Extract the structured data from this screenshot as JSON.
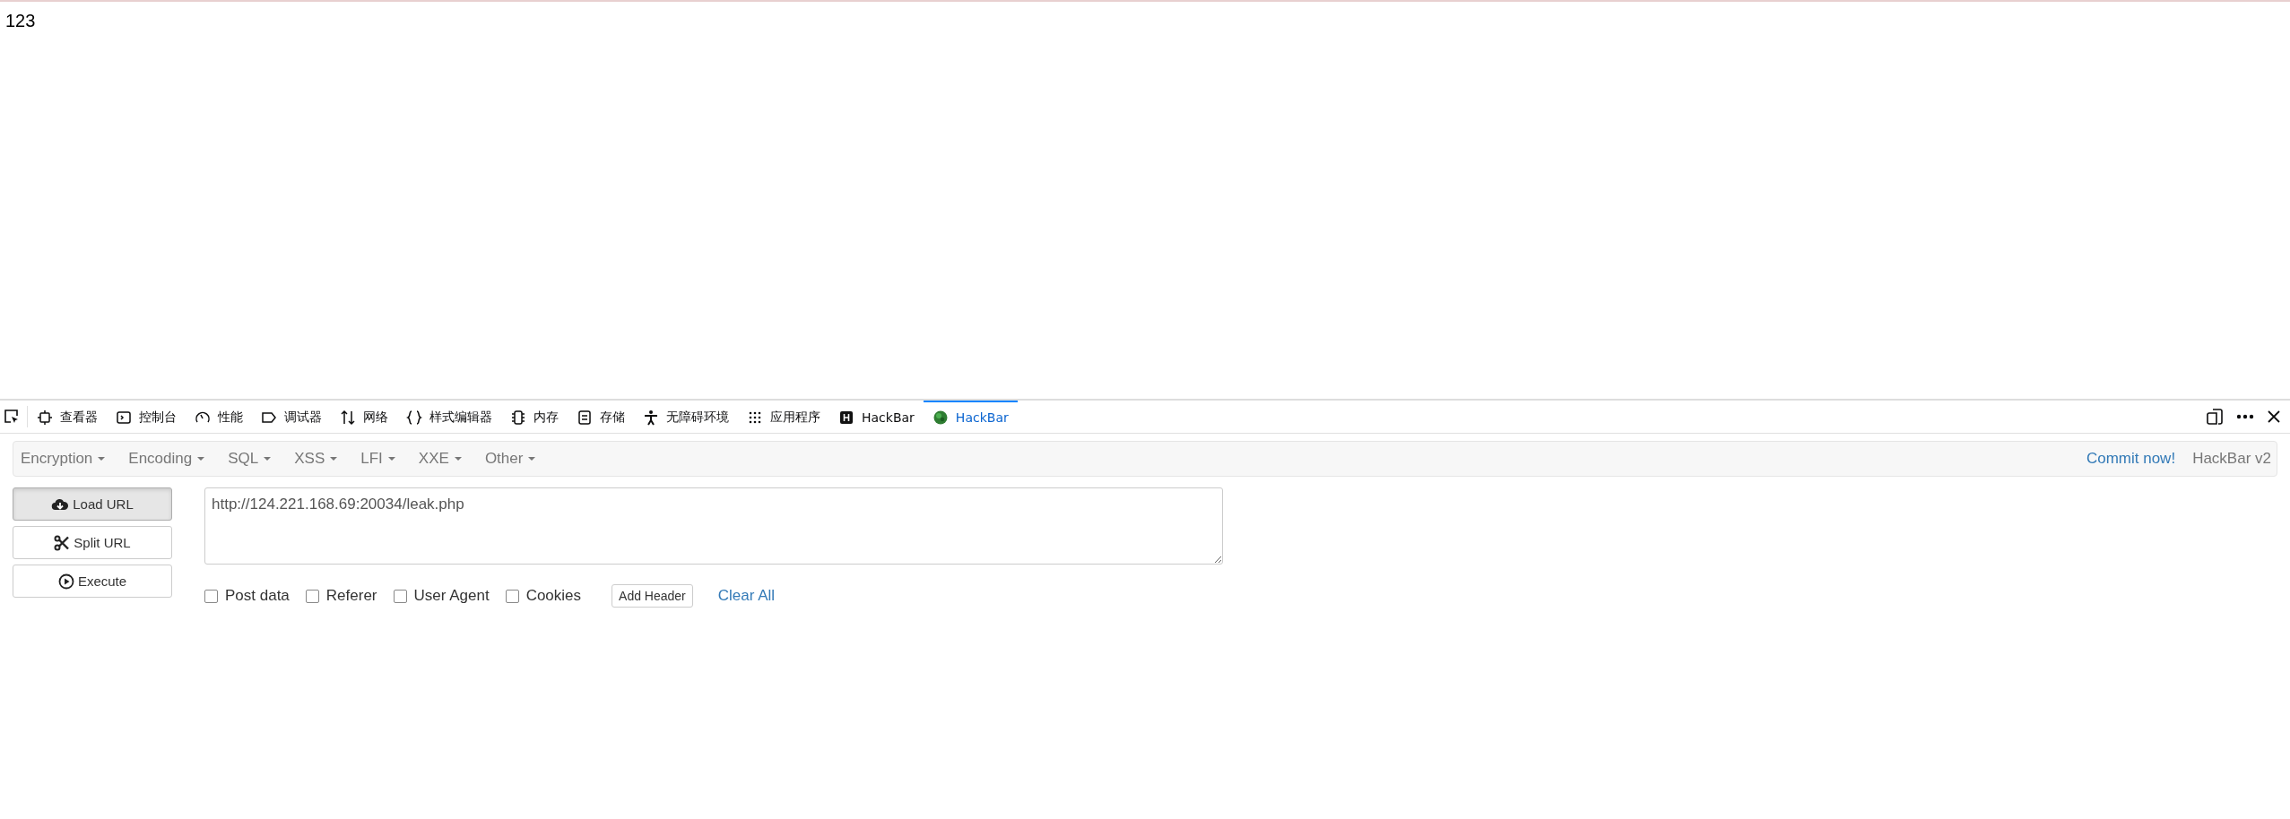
{
  "page": {
    "text": "123"
  },
  "devtools": {
    "tabs": [
      {
        "label": "查看器",
        "selected": false
      },
      {
        "label": "控制台",
        "selected": false
      },
      {
        "label": "性能",
        "selected": false
      },
      {
        "label": "调试器",
        "selected": false
      },
      {
        "label": "网络",
        "selected": false
      },
      {
        "label": "样式编辑器",
        "selected": false
      },
      {
        "label": "内存",
        "selected": false
      },
      {
        "label": "存储",
        "selected": false
      },
      {
        "label": "无障碍环境",
        "selected": false
      },
      {
        "label": "应用程序",
        "selected": false
      },
      {
        "label": "HackBar",
        "selected": false
      },
      {
        "label": "HackBar",
        "selected": true
      }
    ]
  },
  "hackbar": {
    "menus": [
      "Encryption",
      "Encoding",
      "SQL",
      "XSS",
      "LFI",
      "XXE",
      "Other"
    ],
    "commit_link": "Commit now!",
    "version": "HackBar v2",
    "actions": [
      {
        "label": "Load URL",
        "selected": true
      },
      {
        "label": "Split URL",
        "selected": false
      },
      {
        "label": "Execute",
        "selected": false
      }
    ],
    "url": "http://124.221.168.69:20034/leak.php",
    "options": [
      {
        "label": "Post data",
        "checked": false
      },
      {
        "label": "Referer",
        "checked": false
      },
      {
        "label": "User Agent",
        "checked": false
      },
      {
        "label": "Cookies",
        "checked": false
      }
    ],
    "add_header": "Add Header",
    "clear_all": "Clear All"
  }
}
